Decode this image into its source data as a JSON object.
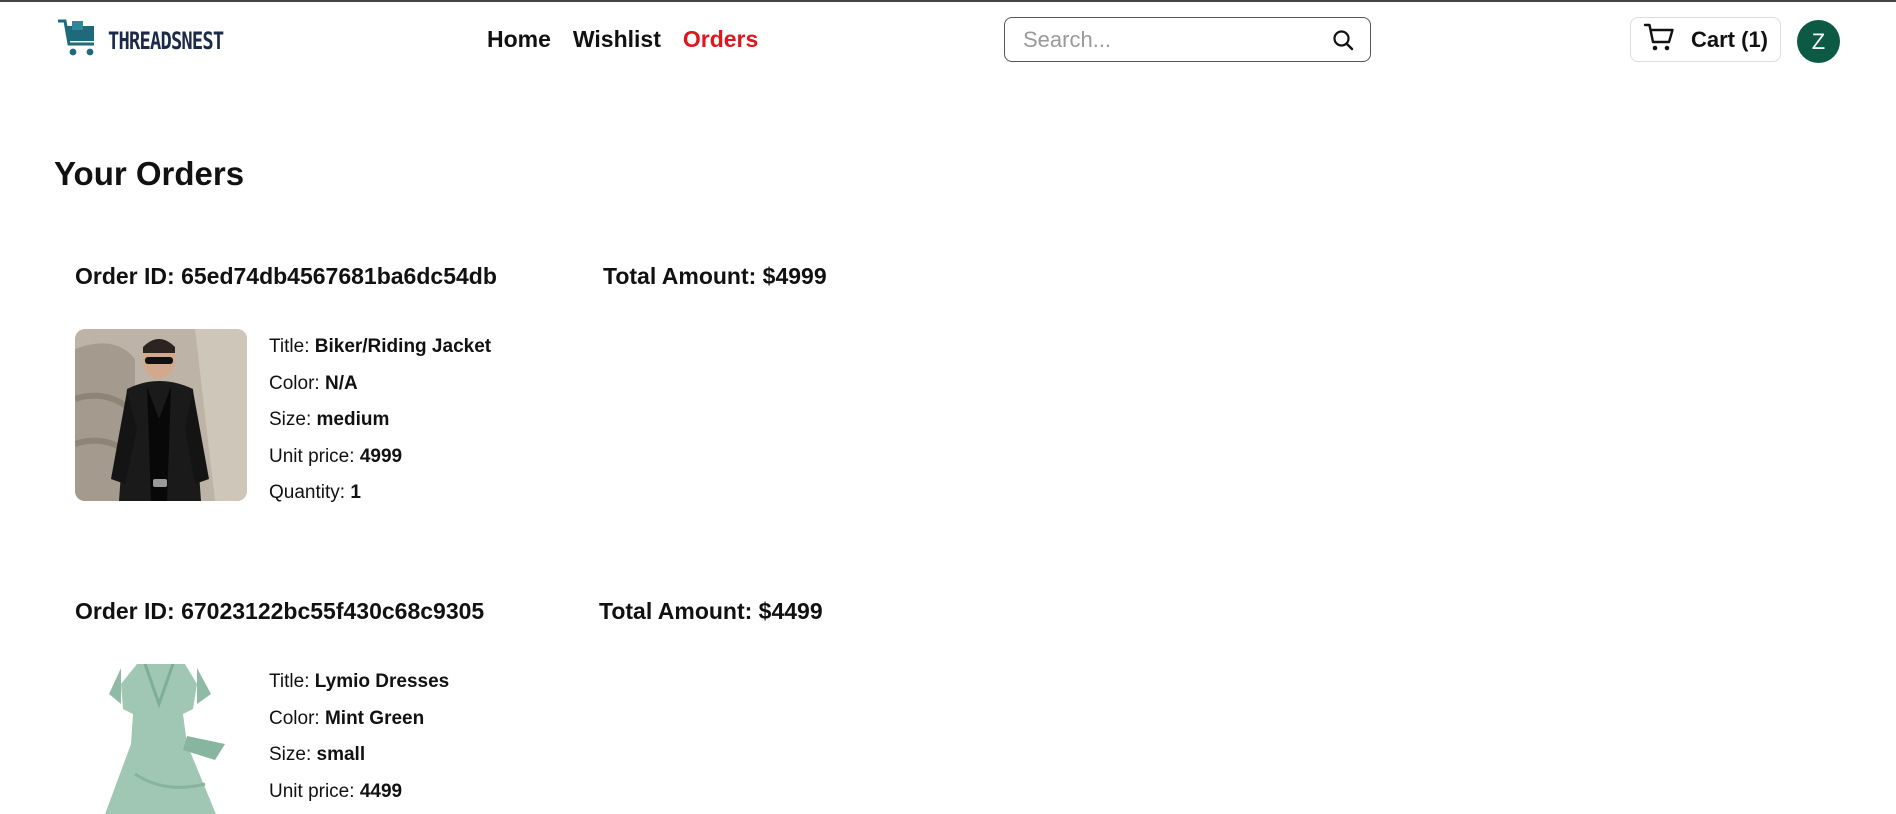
{
  "brand": {
    "name": "THREADSNEST"
  },
  "nav": {
    "home": "Home",
    "wishlist": "Wishlist",
    "orders": "Orders"
  },
  "search": {
    "placeholder": "Search..."
  },
  "cart": {
    "label": "Cart (1)"
  },
  "user": {
    "initial": "Z"
  },
  "page": {
    "title": "Your Orders"
  },
  "labels": {
    "title": "Title: ",
    "color": "Color: ",
    "size": "Size: ",
    "unit_price": "Unit price: ",
    "quantity": "Quantity: "
  },
  "orders": [
    {
      "id_text": "Order ID: 65ed74db4567681ba6dc54db",
      "total_text": "Total Amount: $4999",
      "item": {
        "title": "Biker/Riding Jacket",
        "color": "N/A",
        "size": "medium",
        "unit_price": "4999",
        "quantity": "1"
      }
    },
    {
      "id_text": "Order ID: 67023122bc55f430c68c9305",
      "total_text": "Total Amount: $4499",
      "item": {
        "title": "Lymio Dresses",
        "color": "Mint Green",
        "size": "small",
        "unit_price": "4499"
      }
    }
  ],
  "colors": {
    "accent": "#e0161e",
    "avatar": "#0c5a43",
    "logo": "#1c2a4a"
  }
}
